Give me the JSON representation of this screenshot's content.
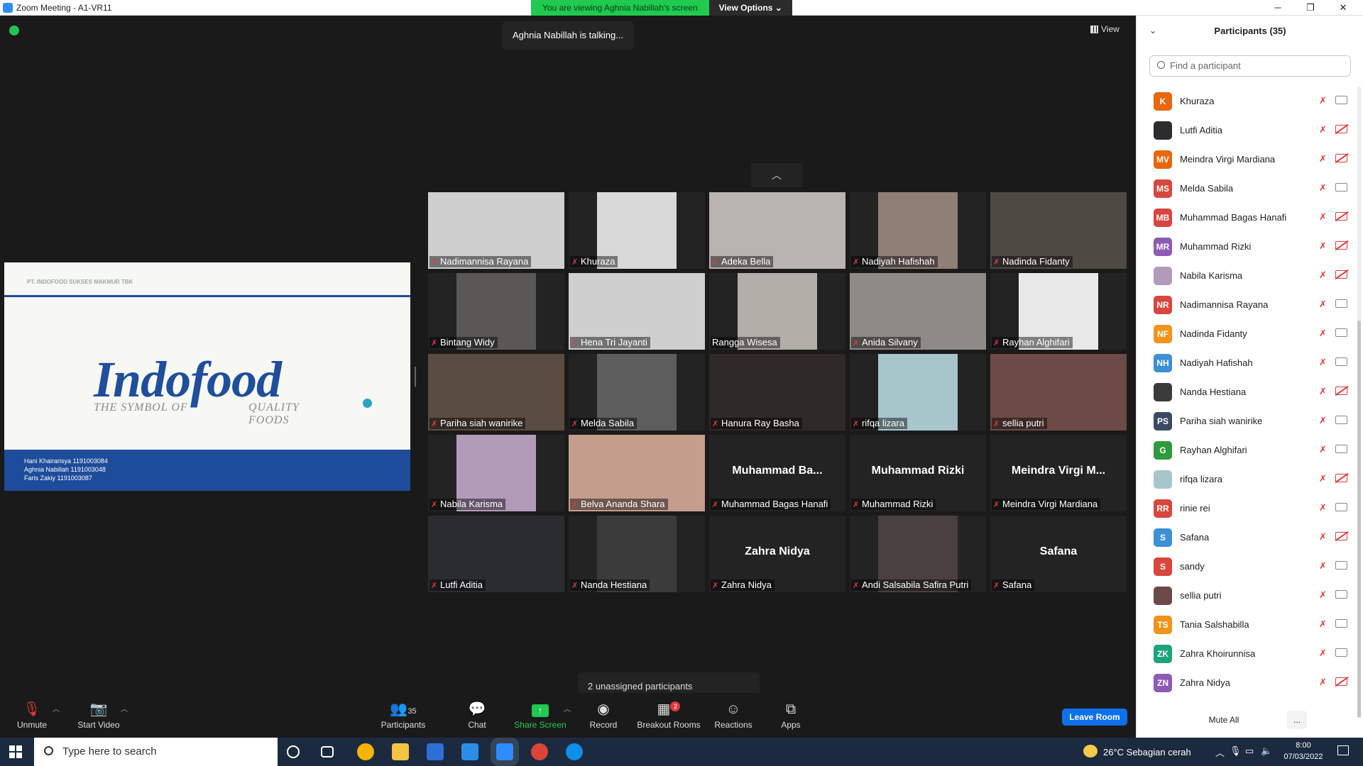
{
  "window": {
    "title": "Zoom Meeting - A1-VR11",
    "minimize": "─",
    "restore": "❐",
    "close": "✕"
  },
  "banner": {
    "viewing": "You are viewing Aghnia Nabillah's screen",
    "view_options": "View Options ⌄"
  },
  "talking": "Aghnia Nabillah is talking...",
  "view_button": "View",
  "slide": {
    "company": "PT. INDOFOOD SUKSES MAKMUR TBK",
    "logo": "Indofood",
    "tagline_left": "THE SYMBOL OF",
    "tagline_right": "QUALITY FOODS",
    "members": [
      "Hani Khairarisya 1191003084",
      "Aghnia Nabillah 1191003048",
      "Faris Zakiy 1191003087"
    ]
  },
  "grid": {
    "up_arrow": "︿",
    "tiles": [
      {
        "name": "Nadimannisa Rayana",
        "muted": true,
        "video": "#cfcfcf"
      },
      {
        "name": "Khuraza",
        "muted": true,
        "video": "#d9d9d9"
      },
      {
        "name": "Adeka Bella",
        "muted": true,
        "video": "#b8b4b0"
      },
      {
        "name": "Nadiyah Hafishah",
        "muted": true,
        "video": "#8f7f76"
      },
      {
        "name": "Nadinda Fidanty",
        "muted": true,
        "video": "#4f4944"
      },
      {
        "name": "Bintang Widy",
        "muted": true,
        "video": "#5a5856"
      },
      {
        "name": "Hena Tri Jayanti",
        "muted": true,
        "video": "#cfcfcf"
      },
      {
        "name": "Rangga Wisesa",
        "muted": false,
        "video": "#b3aea8"
      },
      {
        "name": "Anida Silvany",
        "muted": true,
        "video": "#8f8a86"
      },
      {
        "name": "Rayhan Alghifari",
        "muted": true,
        "video": "#e8e8e8"
      },
      {
        "name": "Pariha siah wanirike",
        "muted": true,
        "video": "#5b4c41"
      },
      {
        "name": "Melda Sabila",
        "muted": true,
        "video": "#5d5d5d"
      },
      {
        "name": "Hanura Ray Basha",
        "muted": true,
        "video": "#2f2a27"
      },
      {
        "name": "rifqa lizara",
        "muted": true,
        "video": "#a7c6cc"
      },
      {
        "name": "sellia putri",
        "muted": true,
        "video": "#6b4a47"
      },
      {
        "name": "Nabila Karisma",
        "muted": true,
        "video": "#b29bb9"
      },
      {
        "name": "Belva Ananda Shara",
        "muted": true,
        "video": "#c59d8d"
      },
      {
        "name": "Muhammad Bagas Hanafi",
        "muted": true,
        "big": "Muhammad  Ba..."
      },
      {
        "name": "Muhammad Rizki",
        "muted": true,
        "big": "Muhammad Rizki"
      },
      {
        "name": "Meindra Virgi Mardiana",
        "muted": true,
        "big": "Meindra  Virgi  M..."
      },
      {
        "name": "Lutfi Aditia",
        "muted": true,
        "video": "#2a2c30"
      },
      {
        "name": "Nanda Hestiana",
        "muted": true,
        "video": "#3b3b3b"
      },
      {
        "name": "Zahra Nidya",
        "muted": true,
        "big": "Zahra Nidya"
      },
      {
        "name": "Andi Salsabila Safira Putri",
        "muted": true,
        "video": "#4a4040"
      },
      {
        "name": "Safana",
        "muted": true,
        "big": "Safana"
      }
    ]
  },
  "panel": {
    "title": "Participants (35)",
    "search_placeholder": "Find a participant",
    "participants": [
      {
        "initials": "K",
        "name": "Khuraza",
        "color": "#e8660c",
        "cam_off": false
      },
      {
        "initials": "",
        "name": "Lutfi Aditia",
        "color": "#2a2c30",
        "cam_off": true
      },
      {
        "initials": "MV",
        "name": "Meindra Virgi Mardiana",
        "color": "#e8660c",
        "cam_off": true
      },
      {
        "initials": "MS",
        "name": "Melda Sabila",
        "color": "#d9463e",
        "cam_off": false
      },
      {
        "initials": "MB",
        "name": "Muhammad Bagas Hanafi",
        "color": "#d9463e",
        "cam_off": true
      },
      {
        "initials": "MR",
        "name": "Muhammad Rizki",
        "color": "#8e5ab5",
        "cam_off": true
      },
      {
        "initials": "",
        "name": "Nabila Karisma",
        "color": "#b29bb9",
        "cam_off": true
      },
      {
        "initials": "NR",
        "name": "Nadimannisa Rayana",
        "color": "#d9463e",
        "cam_off": false
      },
      {
        "initials": "NF",
        "name": "Nadinda Fidanty",
        "color": "#f0941c",
        "cam_off": false
      },
      {
        "initials": "NH",
        "name": "Nadiyah Hafishah",
        "color": "#3d8fd6",
        "cam_off": false
      },
      {
        "initials": "",
        "name": "Nanda Hestiana",
        "color": "#3b3b3b",
        "cam_off": true
      },
      {
        "initials": "PS",
        "name": "Pariha siah wanirike",
        "color": "#3a4a63",
        "cam_off": false
      },
      {
        "initials": "G",
        "name": "Rayhan Alghifari",
        "color": "#2e9a3c",
        "cam_off": false
      },
      {
        "initials": "",
        "name": "rifqa lizara",
        "color": "#a7c6cc",
        "cam_off": true
      },
      {
        "initials": "RR",
        "name": "rinie rei",
        "color": "#d9463e",
        "cam_off": false
      },
      {
        "initials": "S",
        "name": "Safana",
        "color": "#3d8fd6",
        "cam_off": true
      },
      {
        "initials": "S",
        "name": "sandy",
        "color": "#d9463e",
        "cam_off": false
      },
      {
        "initials": "",
        "name": "sellia putri",
        "color": "#6b4a47",
        "cam_off": false
      },
      {
        "initials": "TS",
        "name": "Tania Salshabilla",
        "color": "#f0941c",
        "cam_off": false
      },
      {
        "initials": "ZK",
        "name": "Zahra Khoirunnisa",
        "color": "#1fa37a",
        "cam_off": false
      },
      {
        "initials": "ZN",
        "name": "Zahra Nidya",
        "color": "#8e5ab5",
        "cam_off": true
      }
    ],
    "mute_all": "Mute All",
    "more": "..."
  },
  "toolbar": {
    "unmute": "Unmute",
    "start_video": "Start Video",
    "participants": "Participants",
    "participants_count": "35",
    "chat": "Chat",
    "share_screen": "Share Screen",
    "record": "Record",
    "breakout_rooms": "Breakout Rooms",
    "breakout_badge": "2",
    "reactions": "Reactions",
    "apps": "Apps",
    "leave_room": "Leave Room",
    "unassigned": "2 unassigned participants"
  },
  "taskbar": {
    "search_placeholder": "Type here to search",
    "weather": "26°C  Sebagian cerah",
    "time": "8:00",
    "date": "07/03/2022"
  }
}
